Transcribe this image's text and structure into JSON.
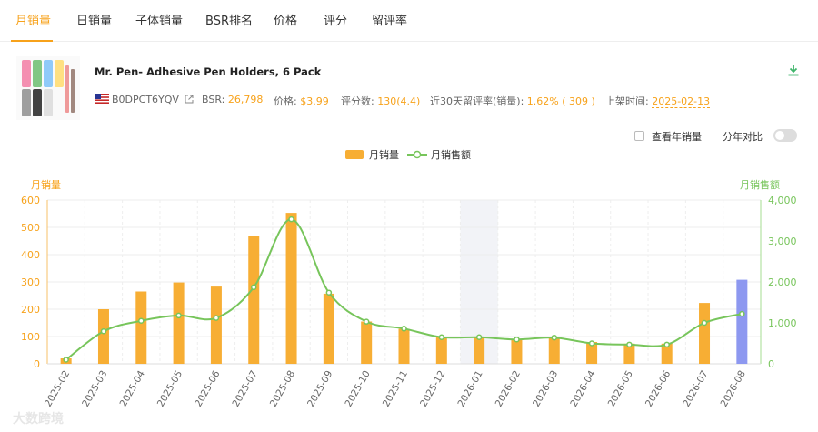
{
  "tabs": [
    {
      "label": "月销量",
      "active": true
    },
    {
      "label": "日销量"
    },
    {
      "label": "子体销量"
    },
    {
      "label": "BSR排名"
    },
    {
      "label": "价格"
    },
    {
      "label": "评分"
    },
    {
      "label": "留评率"
    }
  ],
  "product": {
    "title": "Mr. Pen- Adhesive Pen Holders, 6 Pack",
    "asin": "B0DPCT6YQV",
    "bsr_label": "BSR:",
    "bsr_value": "26,798",
    "price_label": "价格:",
    "price_value": "$3.99",
    "rating_label": "评分数:",
    "rating_value": "130(4.4)",
    "review_rate_label": "近30天留评率(销量):",
    "review_rate_value": "1.62% ( 309 )",
    "listed_label": "上架时间:",
    "listed_value": "2025-02-13"
  },
  "options": {
    "yearly_label": "查看年销量",
    "yoy_label": "分年对比"
  },
  "colors": {
    "accent": "#f7a21b",
    "bar": "#f7ae34",
    "bar_highlight": "#8d98f0",
    "line": "#77c55b"
  },
  "watermark": "大数跨境",
  "chart_data": {
    "type": "bar",
    "categories": [
      "2025-02",
      "2025-03",
      "2025-04",
      "2025-05",
      "2025-06",
      "2025-07",
      "2025-08",
      "2025-09",
      "2025-10",
      "2025-11",
      "2025-12",
      "2026-01",
      "2026-02",
      "2026-03",
      "2026-04",
      "2026-05",
      "2026-06",
      "2026-07",
      "2026-08"
    ],
    "series": [
      {
        "name": "月销量",
        "type": "bar",
        "axis": "left",
        "values": [
          20,
          200,
          265,
          298,
          283,
          470,
          553,
          257,
          155,
          128,
          98,
          98,
          90,
          96,
          80,
          74,
          74,
          223,
          308
        ]
      },
      {
        "name": "月销售额",
        "type": "line",
        "axis": "right",
        "values": [
          100,
          795,
          1050,
          1180,
          1120,
          1870,
          3530,
          1740,
          1030,
          860,
          650,
          650,
          595,
          640,
          500,
          470,
          470,
          1000,
          1220
        ]
      }
    ],
    "ylabel": "月销量",
    "y2label": "月销售额",
    "ylim": [
      0,
      600
    ],
    "y2lim": [
      0,
      4000
    ],
    "yticks": [
      "0",
      "100",
      "200",
      "300",
      "400",
      "500",
      "600"
    ],
    "y2ticks": [
      "0",
      "1,000",
      "2,000",
      "3,000",
      "4,000"
    ],
    "highlight_bar_category": "2026-08",
    "shaded_category": "2026-01",
    "grid": true,
    "legend_position": "top-center"
  }
}
